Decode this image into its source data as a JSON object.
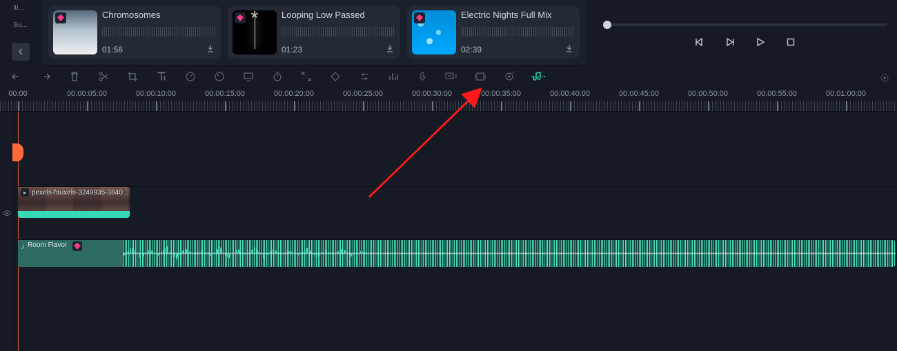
{
  "left_nav": {
    "label_truncated": "iti...",
    "label2": "Su..."
  },
  "media": {
    "items": [
      {
        "title": "Chromosomes",
        "duration": "01:56"
      },
      {
        "title": "Looping Low Passed",
        "duration": "01:23"
      },
      {
        "title": "Electric Nights Full Mix",
        "duration": "02:39"
      }
    ]
  },
  "ruler": {
    "labels": [
      "00:00",
      "00:00:05:00",
      "00:00:10:00",
      "00:00:15:00",
      "00:00:20:00",
      "00:00:25:00",
      "00:00:30:00",
      "00:00:35:00",
      "00:00:40:00",
      "00:00:45:00",
      "00:00:50:00",
      "00:00:55:00",
      "00:01:00:00"
    ]
  },
  "clips": {
    "video_name": "pexels-fauxels-3249935-3840...",
    "audio_name": "Room Flavor"
  },
  "colors": {
    "accent": "#38d9b8",
    "playhead": "#ff6a3d",
    "diamond": "#ff3b84"
  }
}
